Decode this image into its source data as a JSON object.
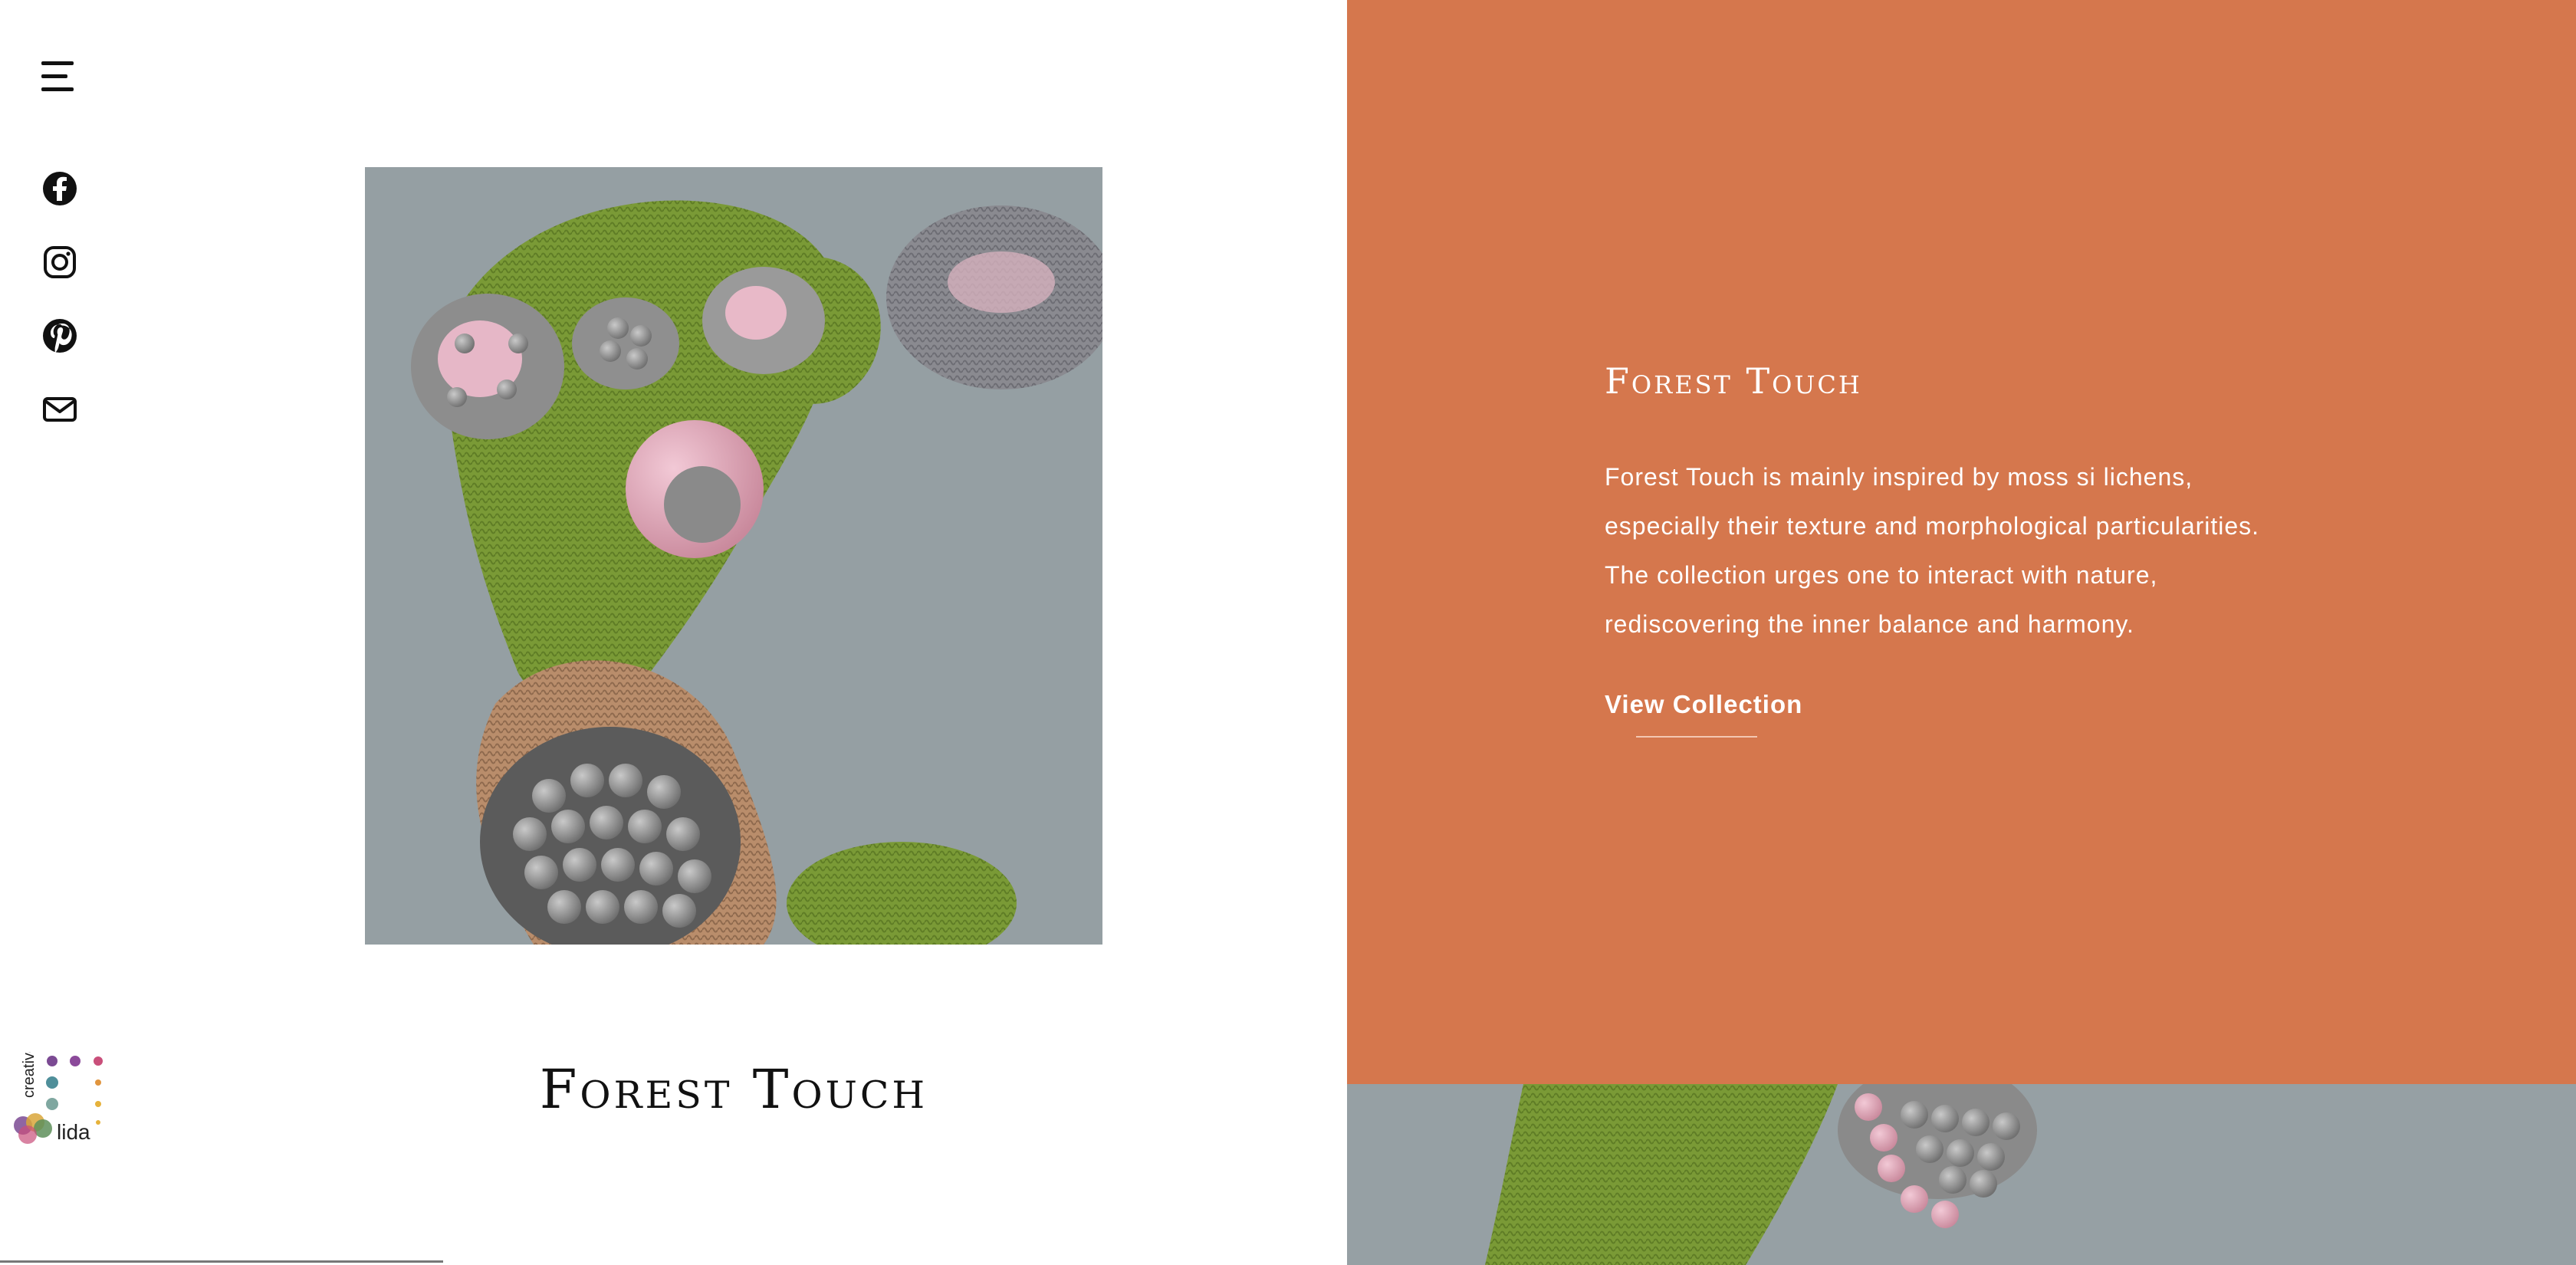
{
  "nav": {
    "menu_icon": "hamburger-menu-icon",
    "social": [
      {
        "name": "facebook-icon"
      },
      {
        "name": "instagram-icon"
      },
      {
        "name": "pinterest-icon"
      },
      {
        "name": "mail-icon"
      }
    ]
  },
  "logo": {
    "text_top": "creative",
    "text_bottom": "lida",
    "colors": [
      "#7b4a93",
      "#4f8f9a",
      "#c94f7a",
      "#e1953e",
      "#e6b23b"
    ]
  },
  "left": {
    "title": "Forest Touch"
  },
  "panel": {
    "background": "#d5774d",
    "title": "Forest Touch",
    "description_lines": [
      "Forest Touch is mainly inspired by moss si lichens,",
      "especially their texture and morphological particularities.",
      "The collection urges one to interact with nature,",
      "rediscovering the inner balance and harmony."
    ],
    "button_label": "View Collection"
  }
}
